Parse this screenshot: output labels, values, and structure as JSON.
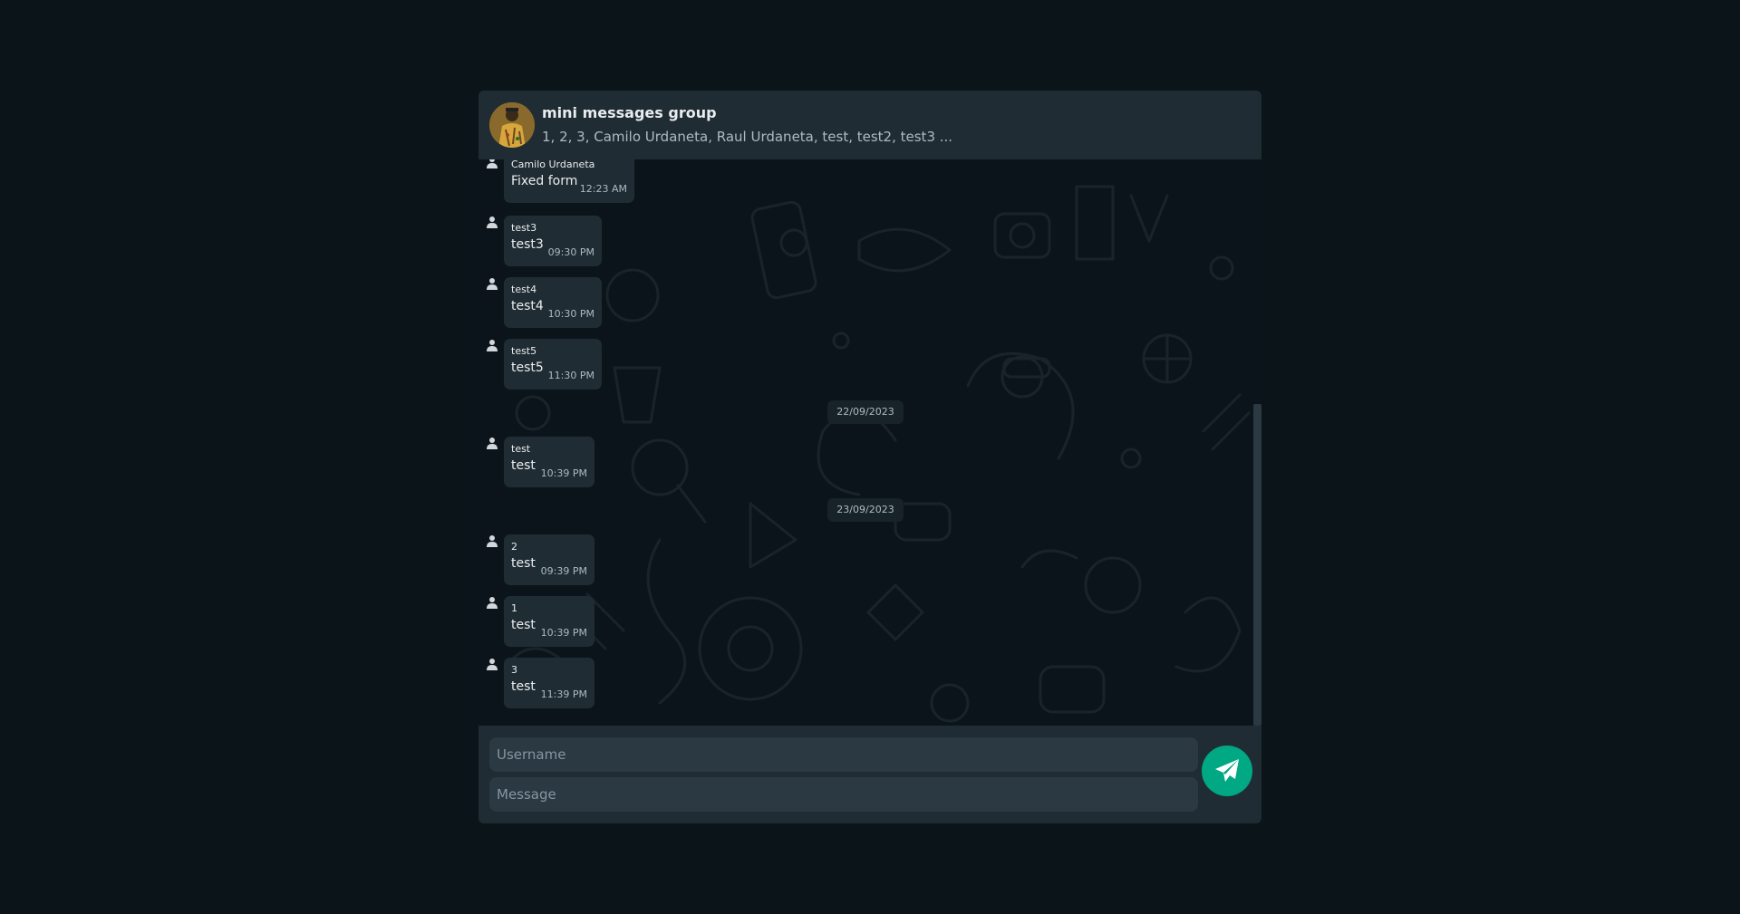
{
  "colors": {
    "page_background": "#0b1418",
    "header_background": "#1f2c33",
    "bubble_background": "#202c33",
    "send_button": "#00a884",
    "primary_text": "#e9edef",
    "secondary_text": "#aebac1"
  },
  "header": {
    "group_name": "mini messages group",
    "members": "1, 2, 3, Camilo Urdaneta, Raul Urdaneta, test, test2, test3 ...",
    "avatar_icon": "group-avatar-photo"
  },
  "messages": [
    {
      "sender": "Camilo Urdaneta",
      "text": "Fixed form",
      "time": "12:23 AM",
      "icon": "user-icon"
    },
    {
      "sender": "test3",
      "text": "test3",
      "time": "09:30 PM",
      "icon": "user-icon"
    },
    {
      "sender": "test4",
      "text": "test4",
      "time": "10:30 PM",
      "icon": "user-icon"
    },
    {
      "sender": "test5",
      "text": "test5",
      "time": "11:30 PM",
      "icon": "user-icon"
    },
    {
      "date_separator": "22/09/2023"
    },
    {
      "sender": "test",
      "text": "test",
      "time": "10:39 PM",
      "icon": "user-icon"
    },
    {
      "date_separator": "23/09/2023"
    },
    {
      "sender": "2",
      "text": "test",
      "time": "09:39 PM",
      "icon": "user-icon"
    },
    {
      "sender": "1",
      "text": "test",
      "time": "10:39 PM",
      "icon": "user-icon"
    },
    {
      "sender": "3",
      "text": "test",
      "time": "11:39 PM",
      "icon": "user-icon"
    }
  ],
  "composer": {
    "username_placeholder": "Username",
    "username_value": "",
    "message_placeholder": "Message",
    "message_value": "",
    "send_icon": "paper-plane-icon"
  }
}
